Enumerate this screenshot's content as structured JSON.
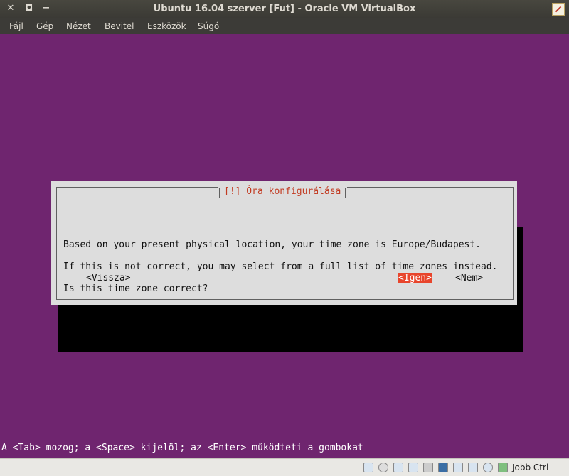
{
  "window": {
    "title": "Ubuntu 16.04 szerver [Fut] - Oracle VM VirtualBox"
  },
  "menu": [
    "Fájl",
    "Gép",
    "Nézet",
    "Bevitel",
    "Eszközök",
    "Súgó"
  ],
  "dialog": {
    "title": "[!] Óra konfigurálása",
    "lines": [
      "Based on your present physical location, your time zone is Europe/Budapest.",
      "If this is not correct, you may select from a full list of time zones instead.",
      "Is this time zone correct?"
    ],
    "buttons": {
      "back": "<Vissza>",
      "yes": "<Igen>",
      "no": "<Nem>"
    },
    "selected": "yes"
  },
  "hint": "A <Tab> mozog; a <Space> kijelöl; az <Enter> működteti a gombokat",
  "statusbar": {
    "icons": [
      "harddisk-icon",
      "optical-icon",
      "audio-icon",
      "network-icon",
      "usb-icon",
      "shared-folder-icon",
      "display-icon",
      "video-capture-icon",
      "cpu-icon",
      "mouse-integration-icon",
      "arrow-down-icon"
    ],
    "host_key": "Jobb Ctrl"
  },
  "colors": {
    "background": "#6f256f",
    "dialog": "#dddddd",
    "accent": "#e8452c"
  }
}
